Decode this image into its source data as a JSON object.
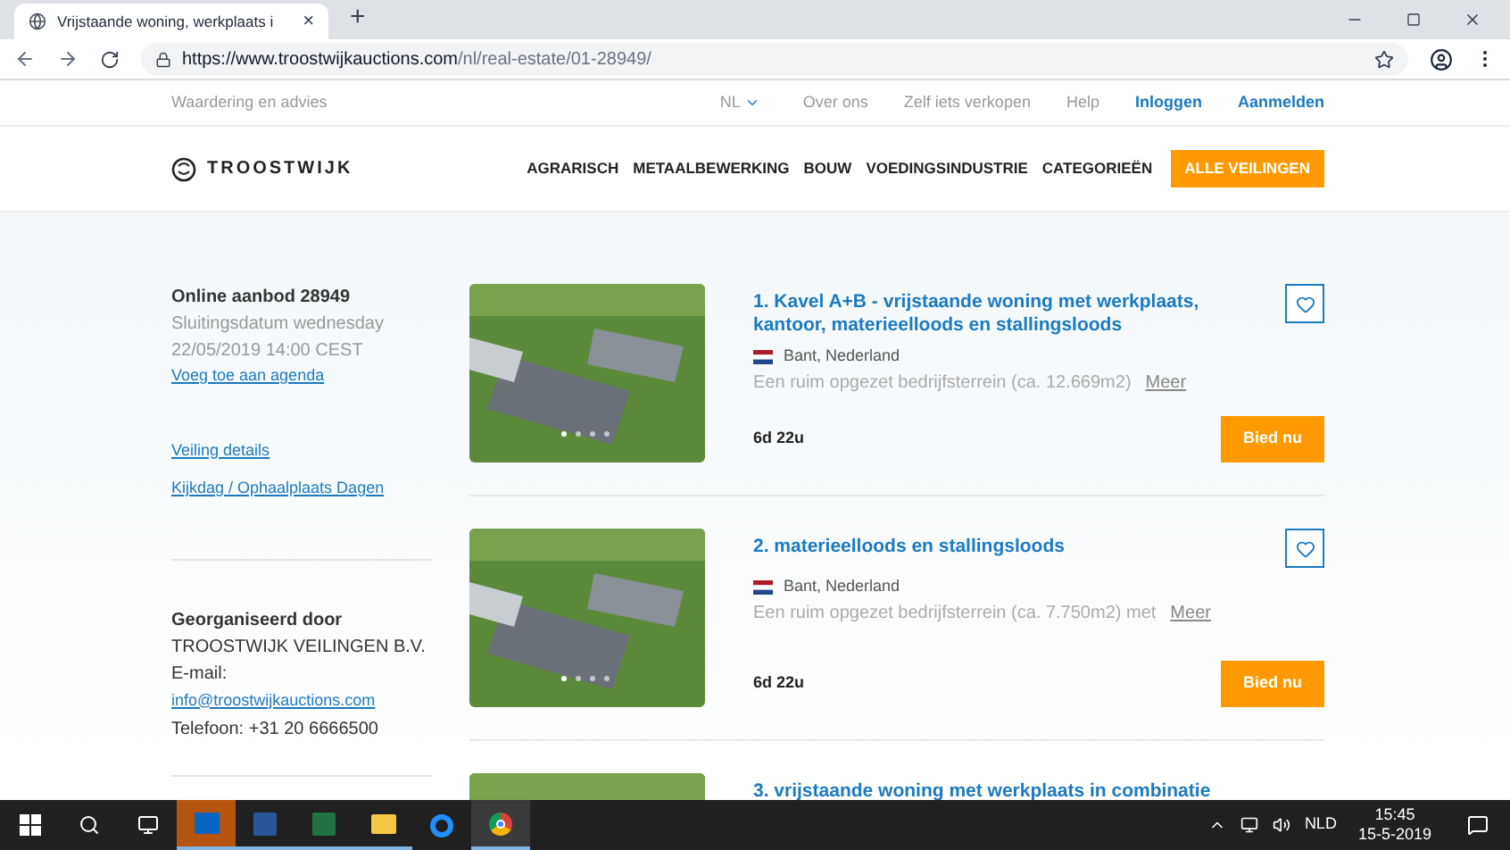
{
  "browser": {
    "tab_title": "Vrijstaande woning, werkplaats i",
    "tab_close": "×",
    "new_tab": "+",
    "url_host": "https://www.troostwijkauctions.com",
    "url_path": "/nl/real-estate/01-28949/"
  },
  "utility_nav": {
    "left": "Waardering en advies",
    "language": "NL",
    "links": [
      {
        "label": "Over ons",
        "kind": "plain"
      },
      {
        "label": "Zelf iets verkopen",
        "kind": "plain"
      },
      {
        "label": "Help",
        "kind": "plain"
      },
      {
        "label": "Inloggen",
        "kind": "accent"
      },
      {
        "label": "Aanmelden",
        "kind": "accent"
      }
    ]
  },
  "header": {
    "logo": "TROOSTWIJK",
    "nav": [
      "AGRARISCH",
      "METAALBEWERKING",
      "BOUW",
      "VOEDINGSINDUSTRIE",
      "CATEGORIEËN"
    ],
    "cta": "ALLE VEILINGEN"
  },
  "sidebar": {
    "title": "Online aanbod 28949",
    "closing": [
      "Sluitingsdatum wednesday",
      "22/05/2019 14:00 CEST"
    ],
    "agenda_link": "Voeg toe aan agenda",
    "links": [
      "Veiling details",
      "Kijkdag / Ophaalplaats Dagen"
    ],
    "organizer_title": "Georganiseerd door",
    "organizer": "TROOSTWIJK VEILINGEN B.V.",
    "email_label": "E-mail:",
    "email": "info@troostwijkauctions.com",
    "phone": "Telefoon: +31 20 6666500"
  },
  "lots": [
    {
      "title": "1. Kavel A+B - vrijstaande woning met werkplaats, kantoor, materieelloods en stallingsloods",
      "location": "Bant, Nederland",
      "description": "Een ruim opgezet bedrijfsterrein (ca. 12.669m2)",
      "more": "Meer",
      "time_left": "6d 22u",
      "bid": "Bied nu"
    },
    {
      "title": "2. materieelloods en stallingsloods",
      "location": "Bant, Nederland",
      "description": "Een ruim opgezet bedrijfsterrein (ca. 7.750m2) met",
      "more": "Meer",
      "time_left": "6d 22u",
      "bid": "Bied nu"
    },
    {
      "title": "3. vrijstaande woning met werkplaats in combinatie"
    }
  ],
  "taskbar": {
    "language": "NLD",
    "time": "15:45",
    "date": "15-5-2019"
  }
}
